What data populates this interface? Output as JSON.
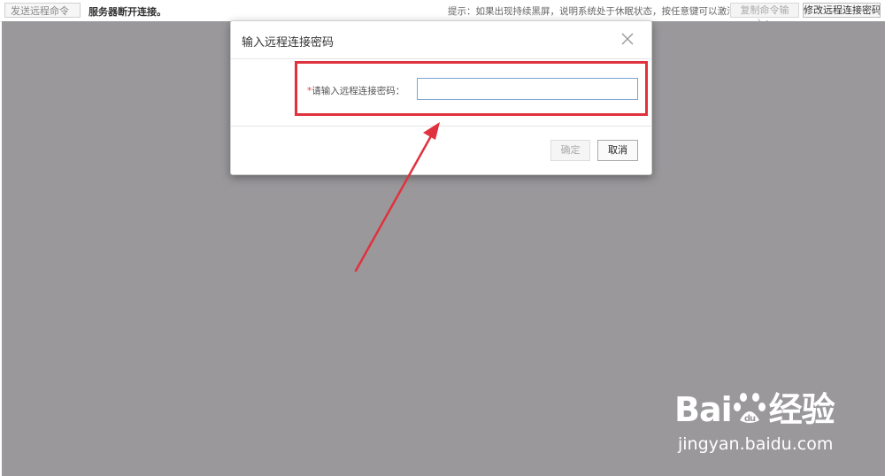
{
  "toolbar": {
    "send_command_label": "发送远程命令",
    "server_status": "服务器断开连接。",
    "hint": "提示：如果出现持续黑屏，说明系统处于休眠状态，按任意键可以激活。",
    "copy_command_label": "复制命令输入：",
    "modify_password_label": "修改远程连接密码"
  },
  "modal": {
    "title": "输入远程连接密码",
    "required_mark": "*",
    "password_label": "请输入远程连接密码：",
    "password_value": "",
    "ok_label": "确定",
    "cancel_label": "取消"
  },
  "watermark": {
    "brand": "Bai",
    "brand_cn": "经验",
    "url": "jingyan.baidu.com"
  },
  "colors": {
    "screen_bg": "#9a989b",
    "highlight": "#e0323e",
    "input_border": "#7ba4d1"
  }
}
